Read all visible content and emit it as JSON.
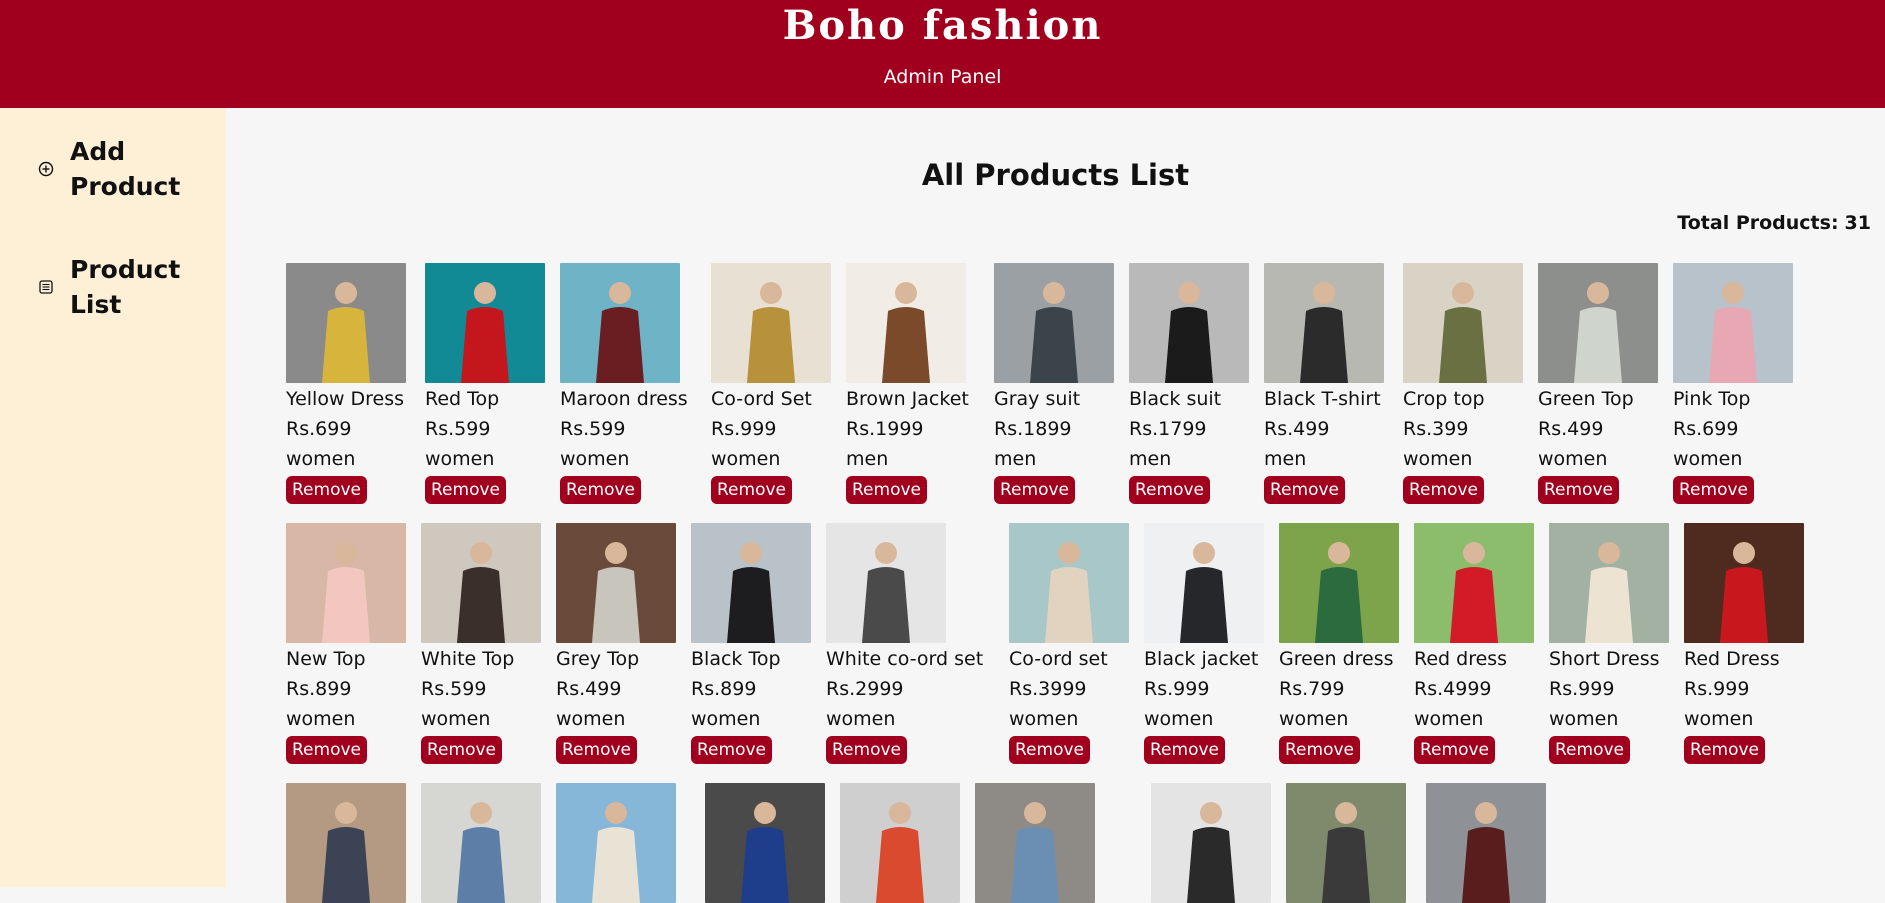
{
  "header": {
    "brand": "Boho fashion",
    "subtitle": "Admin Panel"
  },
  "sidebar": {
    "items": [
      {
        "label": "Add Product",
        "icon": "plus-circle-icon"
      },
      {
        "label": "Product List",
        "icon": "list-icon"
      }
    ]
  },
  "main": {
    "title": "All Products List",
    "total_label": "Total Products:",
    "total_count": "31",
    "remove_label": "Remove"
  },
  "products": [
    {
      "name": "Yellow Dress",
      "price": "Rs.699",
      "category": "women",
      "colors": [
        "#8a8a8a",
        "#d7b53d"
      ]
    },
    {
      "name": "Red Top",
      "price": "Rs.599",
      "category": "women",
      "colors": [
        "#128a96",
        "#c4171d"
      ]
    },
    {
      "name": "Maroon dress",
      "price": "Rs.599",
      "category": "women",
      "colors": [
        "#6fb3c7",
        "#6a1e22"
      ]
    },
    {
      "name": "Co-ord Set",
      "price": "Rs.999",
      "category": "women",
      "colors": [
        "#e8e1d3",
        "#b8913b"
      ]
    },
    {
      "name": "Brown Jacket",
      "price": "Rs.1999",
      "category": "men",
      "colors": [
        "#f1ece6",
        "#7a4a2b"
      ]
    },
    {
      "name": "Gray suit",
      "price": "Rs.1899",
      "category": "men",
      "colors": [
        "#9aa0a3",
        "#3b434b"
      ]
    },
    {
      "name": "Black suit",
      "price": "Rs.1799",
      "category": "men",
      "colors": [
        "#b9b9b9",
        "#1b1b1b"
      ]
    },
    {
      "name": "Black T-shirt",
      "price": "Rs.499",
      "category": "men",
      "colors": [
        "#b7b8b2",
        "#2b2b2b"
      ]
    },
    {
      "name": "Crop top",
      "price": "Rs.399",
      "category": "women",
      "colors": [
        "#d9d3c6",
        "#6b7042"
      ]
    },
    {
      "name": "Green Top",
      "price": "Rs.499",
      "category": "women",
      "colors": [
        "#8c8f8b",
        "#cfd4cc"
      ]
    },
    {
      "name": "Pink Top",
      "price": "Rs.699",
      "category": "women",
      "colors": [
        "#b7c2cb",
        "#e7a7b3"
      ]
    },
    {
      "name": "New Top",
      "price": "Rs.899",
      "category": "women",
      "colors": [
        "#d8b7a6",
        "#f1c7c0"
      ]
    },
    {
      "name": "White Top",
      "price": "Rs.599",
      "category": "women",
      "colors": [
        "#cfc8bf",
        "#3a2f2a"
      ]
    },
    {
      "name": "Grey Top",
      "price": "Rs.499",
      "category": "women",
      "colors": [
        "#6a4b3b",
        "#c8c5bd"
      ]
    },
    {
      "name": "Black Top",
      "price": "Rs.899",
      "category": "women",
      "colors": [
        "#b9c2c8",
        "#1d1d1f"
      ]
    },
    {
      "name": "White co-ord set",
      "price": "Rs.2999",
      "category": "women",
      "colors": [
        "#e5e5e5",
        "#4a4a4a"
      ]
    },
    {
      "name": "Co-ord set",
      "price": "Rs.3999",
      "category": "women",
      "colors": [
        "#a7c7c9",
        "#e2d3c0"
      ]
    },
    {
      "name": "Black jacket",
      "price": "Rs.999",
      "category": "women",
      "colors": [
        "#eef0f2",
        "#26272b"
      ]
    },
    {
      "name": "Green dress",
      "price": "Rs.799",
      "category": "women",
      "colors": [
        "#7ea44b",
        "#2c6b3e"
      ]
    },
    {
      "name": "Red dress",
      "price": "Rs.4999",
      "category": "women",
      "colors": [
        "#8bbd6c",
        "#d31b27"
      ]
    },
    {
      "name": "Short Dress",
      "price": "Rs.999",
      "category": "women",
      "colors": [
        "#a3b1a3",
        "#ece3d3"
      ]
    },
    {
      "name": "Red Dress",
      "price": "Rs.999",
      "category": "women",
      "colors": [
        "#4f2a1e",
        "#c8181d"
      ]
    },
    {
      "name": "",
      "price": "",
      "category": "",
      "colors": [
        "#b49a82",
        "#3b4355"
      ]
    },
    {
      "name": "",
      "price": "",
      "category": "",
      "colors": [
        "#d6d6d2",
        "#5d7ea6"
      ]
    },
    {
      "name": "",
      "price": "",
      "category": "",
      "colors": [
        "#86b6d8",
        "#e9e3d6"
      ]
    },
    {
      "name": "",
      "price": "",
      "category": "",
      "colors": [
        "#4a4a4a",
        "#1e3d8b"
      ]
    },
    {
      "name": "",
      "price": "",
      "category": "",
      "colors": [
        "#cfcfcf",
        "#d94a2e"
      ]
    },
    {
      "name": "",
      "price": "",
      "category": "",
      "colors": [
        "#8e8b86",
        "#6b8fb3"
      ]
    },
    {
      "name": "",
      "price": "",
      "category": "",
      "colors": [
        "#e4e4e4",
        "#2a2a2a"
      ]
    },
    {
      "name": "",
      "price": "",
      "category": "",
      "colors": [
        "#7f8a6c",
        "#3a3a3a"
      ]
    },
    {
      "name": "",
      "price": "",
      "category": "",
      "colors": [
        "#8e9297",
        "#5a1d1d"
      ]
    }
  ]
}
